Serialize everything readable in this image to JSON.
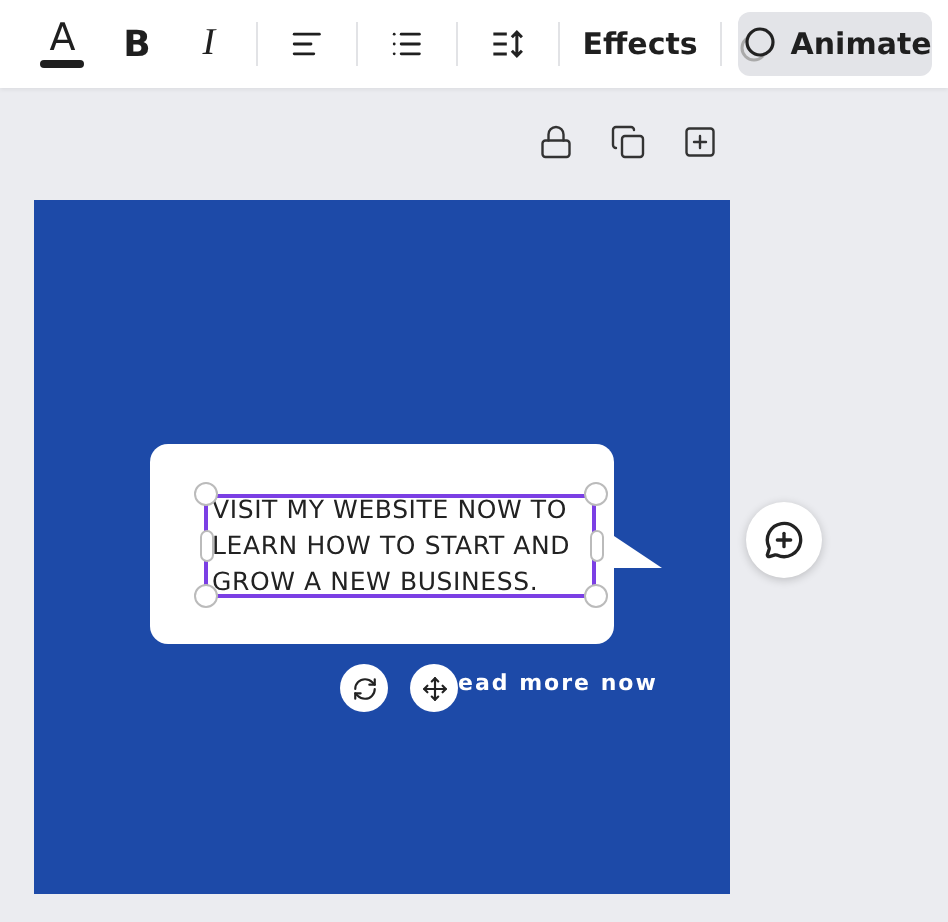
{
  "toolbar": [
    {
      "kind": "text-color",
      "glyph": "A",
      "color": "#1f1f1f"
    },
    {
      "kind": "bold",
      "glyph": "B"
    },
    {
      "kind": "italic",
      "glyph": "I"
    },
    {
      "kind": "align"
    },
    {
      "kind": "list"
    },
    {
      "kind": "spacing"
    },
    {
      "kind": "text",
      "label": "Effects",
      "selected": false
    },
    {
      "kind": "animate",
      "label": "Animate",
      "selected": true
    }
  ],
  "canvas_actions": [
    {
      "kind": "lock"
    },
    {
      "kind": "duplicate"
    },
    {
      "kind": "add-page"
    }
  ],
  "design": {
    "bubble_lines": [
      "VISIT MY WEBSITE NOW TO",
      "LEARN HOW TO START AND",
      "GROW A NEW BUSINESS."
    ],
    "caption": "ead more now"
  }
}
